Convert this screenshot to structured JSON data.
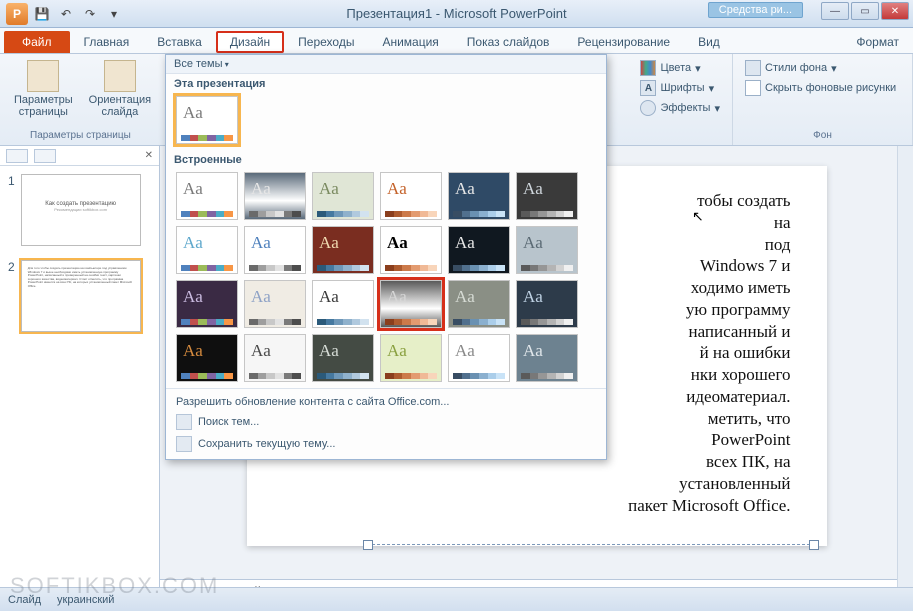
{
  "title": "Презентация1  -  Microsoft PowerPoint",
  "contextual_tab": "Средства ри...",
  "format_tab": "Формат",
  "qat": {
    "save": "save-icon",
    "undo": "undo-icon",
    "redo": "redo-icon"
  },
  "tabs": {
    "file": "Файл",
    "home": "Главная",
    "insert": "Вставка",
    "design": "Дизайн",
    "transitions": "Переходы",
    "animation": "Анимация",
    "slideshow": "Показ слайдов",
    "review": "Рецензирование",
    "view": "Вид"
  },
  "ribbon": {
    "page_setup_group": "Параметры страницы",
    "page_setup": "Параметры\nстраницы",
    "orientation": "Ориентация\nслайда",
    "colors": "Цвета",
    "fonts": "Шрифты",
    "effects": "Эффекты",
    "bg_styles": "Стили фона",
    "hide_bg": "Скрыть фоновые рисунки",
    "bg_group": "Фон"
  },
  "gallery": {
    "all_themes": "Все темы",
    "this_presentation": "Эта презентация",
    "builtin": "Встроенные",
    "theme_sample": "Aa",
    "footer_enable_update": "Разрешить обновление контента с сайта Office.com...",
    "footer_search": "Поиск тем...",
    "footer_save_current": "Сохранить текущую тему..."
  },
  "theme_colors": {
    "stripes": [
      [
        "#4f81bd",
        "#c0504d",
        "#9bbb59",
        "#8064a2",
        "#4bacc6",
        "#f79646"
      ],
      [
        "#6a6a6a",
        "#9e9e9e",
        "#c8c8c8",
        "#e2e2e2",
        "#7a7a7a",
        "#4d4d4d"
      ],
      [
        "#2b5a7a",
        "#4679a0",
        "#6f98b9",
        "#8fb1cc",
        "#b0c9de",
        "#d2e2ef"
      ],
      [
        "#8a3e1d",
        "#ad5b2f",
        "#cc7a4a",
        "#e39b70",
        "#f0b996",
        "#f8d5ba"
      ],
      [
        "#384d63",
        "#51708e",
        "#6a91b2",
        "#8bb0cf",
        "#abceea",
        "#c9e3f7"
      ],
      [
        "#5a5a5a",
        "#787878",
        "#969696",
        "#b4b4b4",
        "#d2d2d2",
        "#f0f0f0"
      ]
    ]
  },
  "theme_variants": [
    {
      "bg": "#ffffff",
      "fg": "#7a7a7a"
    },
    {
      "bg": "#5a6a7a",
      "fg": "#e6e6e6",
      "grad": true
    },
    {
      "bg": "#e0e6d6",
      "fg": "#7a8a60"
    },
    {
      "bg": "#ffffff",
      "fg": "#c4622a"
    },
    {
      "bg": "#2f4a66",
      "fg": "#e6e6e6"
    },
    {
      "bg": "#3a3a3a",
      "fg": "#cfd6dc"
    },
    {
      "bg": "#ffffff",
      "fg": "#5fa8cc"
    },
    {
      "bg": "#ffffff",
      "fg": "#4f81bd"
    },
    {
      "bg": "#7a2d20",
      "fg": "#f0d9b0"
    },
    {
      "bg": "#ffffff",
      "fg": "#000000",
      "bold": true
    },
    {
      "bg": "#101820",
      "fg": "#e6e6e6"
    },
    {
      "bg": "#b8c4cc",
      "fg": "#5a6a74"
    },
    {
      "bg": "#3a2a44",
      "fg": "#cabbe0"
    },
    {
      "bg": "#f0ece4",
      "fg": "#8ea2c6"
    },
    {
      "bg": "#ffffff",
      "fg": "#3a3a3a"
    },
    {
      "bg": "#5a5a5a",
      "fg": "#d6d6d6",
      "grad": true,
      "highlight": true
    },
    {
      "bg": "#8a8f85",
      "fg": "#d6dbd4"
    },
    {
      "bg": "#2d3b4a",
      "fg": "#bfd2e4"
    },
    {
      "bg": "#0f0f0f",
      "fg": "#d48a3e"
    },
    {
      "bg": "#f6f6f6",
      "fg": "#4a4a4a"
    },
    {
      "bg": "#444b44",
      "fg": "#d6dcd6"
    },
    {
      "bg": "#e6efc8",
      "fg": "#8aa040"
    },
    {
      "bg": "#ffffff",
      "fg": "#8a8a8a"
    },
    {
      "bg": "#6d8290",
      "fg": "#e0e6ea"
    }
  ],
  "slides": {
    "s1": {
      "title": "Как создать презентацию",
      "sub": "Рекомендации softikbox.com"
    },
    "s2": {
      "body": "Для того чтобы создать презентацию на компьютере под управлением Windows 7 и выше необходимо иметь установленную программу PowerPoint, написанный и проверенный на ошибки текст, картинки хорошего качества, видеоматериал. Стоит отметить, что программа PowerPoint имеется на всех ПК, на которых установленный пакет Microsoft Office."
    }
  },
  "slide_visible_text": "тобы   создать\nна\nпод\nWindows 7 и\nходимо иметь\nую программу\nнаписанный и\nй  на  ошибки\nнки хорошего\nидеоматериал.\nметить,      что\nPowerPoint\nвсех  ПК,  на\nустановленный\nпакет Microsoft Office.",
  "notes_placeholder": "Заметки к слайду",
  "status": {
    "slide_info": "Слайд",
    "lang": "украинский"
  },
  "watermark": "SOFTIKBOX.COM"
}
